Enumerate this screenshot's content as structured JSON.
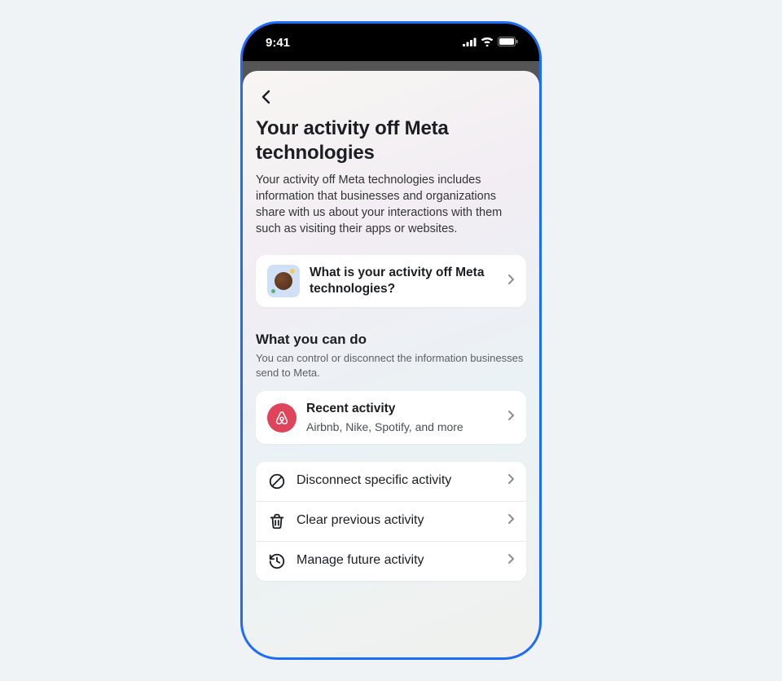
{
  "status": {
    "time": "9:41"
  },
  "header": {
    "title": "Your activity off Meta technologies",
    "description": "Your activity off Meta technologies includes information that businesses and organizations share with us about your interactions with them such as visiting their apps or websites."
  },
  "learn": {
    "title": "What is your activity off Meta technologies?"
  },
  "section": {
    "heading": "What you can do",
    "sub": "You can control or disconnect the information businesses send to Meta."
  },
  "recent": {
    "title": "Recent activity",
    "sub": "Airbnb, Nike, Spotify, and more"
  },
  "actions": {
    "disconnect": "Disconnect specific activity",
    "clear": "Clear previous activity",
    "manage": "Manage future activity"
  }
}
